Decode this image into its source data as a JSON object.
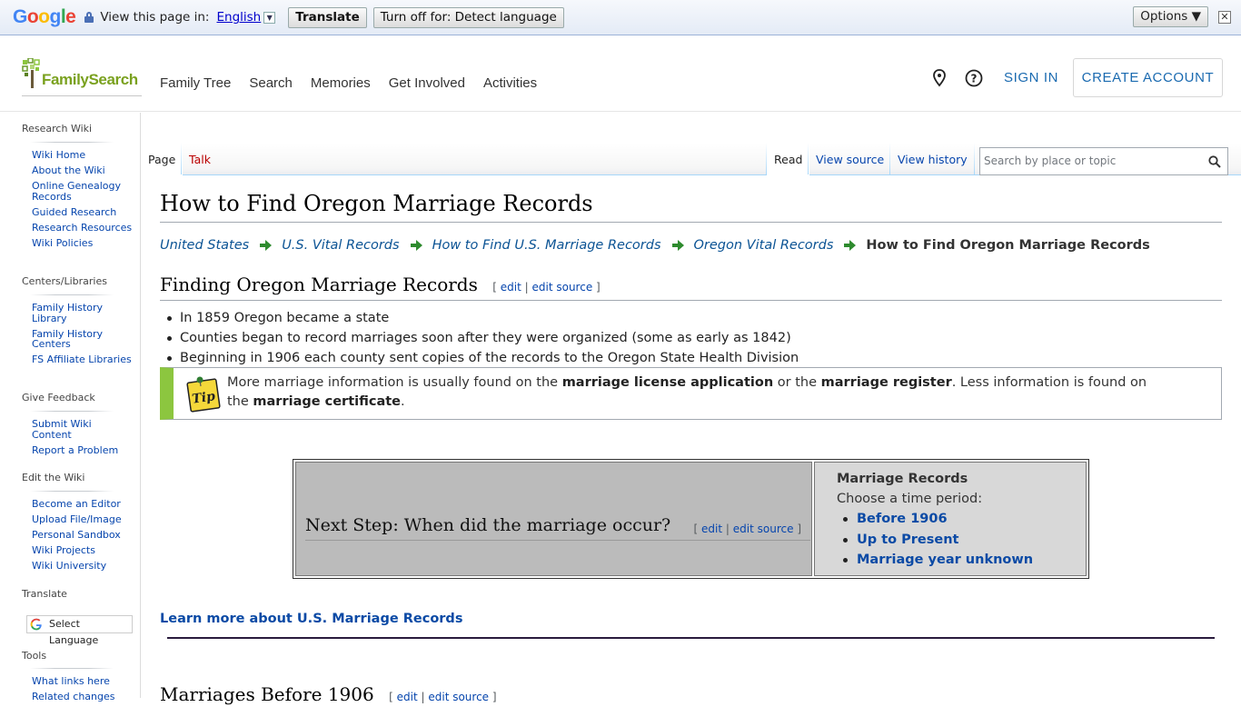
{
  "translate_bar": {
    "logo": "Google",
    "view_text": "View this page in:",
    "language": "English",
    "translate_btn": "Translate",
    "turn_off_btn": "Turn off for: Detect language",
    "options_btn": "Options ▼",
    "close": "✕"
  },
  "header": {
    "logo": "FamilySearch",
    "nav": [
      "Family Tree",
      "Search",
      "Memories",
      "Get Involved",
      "Activities"
    ],
    "sign_in": "SIGN IN",
    "create_account": "CREATE ACCOUNT",
    "icons": [
      "location-pin-icon",
      "help-icon"
    ]
  },
  "sidebar": {
    "sections": [
      {
        "title": "Research Wiki",
        "items": [
          "Wiki Home",
          "About the Wiki",
          "Online Genealogy Records",
          "Guided Research",
          "Research Resources",
          "Wiki Policies"
        ]
      },
      {
        "title": "Centers/Libraries",
        "items": [
          "Family History Library",
          "Family History Centers",
          "FS Affiliate Libraries"
        ]
      },
      {
        "title": "Give Feedback",
        "items": [
          "Submit Wiki Content",
          "Report a Problem"
        ]
      },
      {
        "title": "Edit the Wiki",
        "items": [
          "Become an Editor",
          "Upload File/Image",
          "Personal Sandbox",
          "Wiki Projects",
          "Wiki University"
        ]
      },
      {
        "title": "Translate",
        "items": []
      },
      {
        "title": "Tools",
        "items": [
          "What links here",
          "Related changes"
        ]
      }
    ],
    "select_language": "Select Language"
  },
  "tabs": {
    "page": "Page",
    "talk": "Talk",
    "read": "Read",
    "view_source": "View source",
    "view_history": "View history",
    "search_placeholder": "Search by place or topic"
  },
  "article": {
    "title": "How to Find Oregon Marriage Records",
    "breadcrumbs": [
      "United States",
      "U.S. Vital Records",
      "How to Find U.S. Marriage Records",
      "Oregon Vital Records"
    ],
    "breadcrumb_current": "How to Find Oregon Marriage Records",
    "section1_title": "Finding Oregon Marriage Records",
    "edit_open": "[",
    "edit": "edit",
    "edit_sep": "|",
    "edit_source": "edit source",
    "edit_close": "]",
    "bullets": [
      "In 1859 Oregon became a state",
      "Counties began to record marriages soon after they were organized (some as early as 1842)",
      "Beginning in 1906 each county sent copies of the records to the Oregon State Health Division"
    ],
    "tip": {
      "icon_label": "Tip",
      "t1": "More marriage information is usually found on the ",
      "b1": "marriage license application",
      "t2": " or the ",
      "b2": "marriage register",
      "t3": ". Less information is found on the ",
      "b3": "marriage certificate",
      "t4": "."
    },
    "next_step": {
      "question": "Next Step: When did the marriage occur?",
      "box_title": "Marriage Records",
      "box_sub": "Choose a time period:",
      "options": [
        "Before 1906",
        "Up to Present",
        "Marriage year unknown"
      ]
    },
    "learn_more": "Learn more about U.S. Marriage Records",
    "section2_title": "Marriages Before 1906"
  },
  "colors": {
    "link": "#0645ad",
    "brand_green": "#8cc63f",
    "account_blue": "#1a6ab0",
    "tip_bar": "#8cc63f"
  }
}
